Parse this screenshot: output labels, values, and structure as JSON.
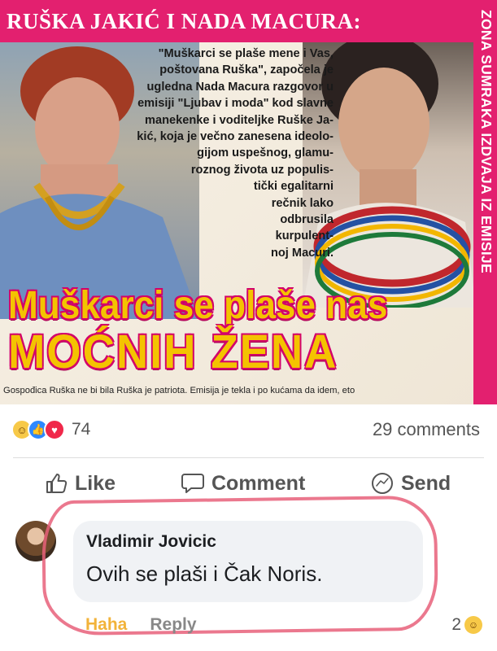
{
  "post": {
    "clipping": {
      "header": "RUŠKA JAKIĆ I NADA MACURA:",
      "side_label": "ZONA SUMRAKA IZDVAJA IZ EMISIJE",
      "lead_lines": [
        "\"Muškarci se plaše mene i Vas,",
        "poštovana Ruška\", započela je",
        "ugledna Nada Macura razgovor u",
        "emisiji \"Ljubav i moda\" kod slavne",
        "manekenke i voditeljke Ruške Ja-",
        "kić, koja je večno zanesena ideolo-",
        "gijom uspešnog, glamu-",
        "roznog života uz populis-",
        "tički egalitarni",
        "rečnik lako",
        "odbrusila",
        "kurpulent-",
        "noj Macuri."
      ],
      "headline_line1": "Muškarci se plaše nas",
      "headline_line2": "MOĆNIH ŽENA",
      "caption": "Gospođica Ruška ne bi bila Ruška je patriota. Emisija je tekla i po kućama da idem, eto"
    },
    "reactions": {
      "count": "74",
      "types": [
        "haha",
        "like",
        "love"
      ]
    },
    "comments_count": "29 comments",
    "actions": {
      "like": "Like",
      "comment": "Comment",
      "send": "Send"
    },
    "colors": {
      "brand_pink": "#e3206f",
      "headline_yellow": "#f4c300",
      "haha_orange": "#f2b33a"
    }
  },
  "comment": {
    "author": "Vladimir Jovicic",
    "text": "Ovih se plaši i Čak Noris.",
    "haha_label": "Haha",
    "reply_label": "Reply",
    "reaction_count": "2"
  }
}
